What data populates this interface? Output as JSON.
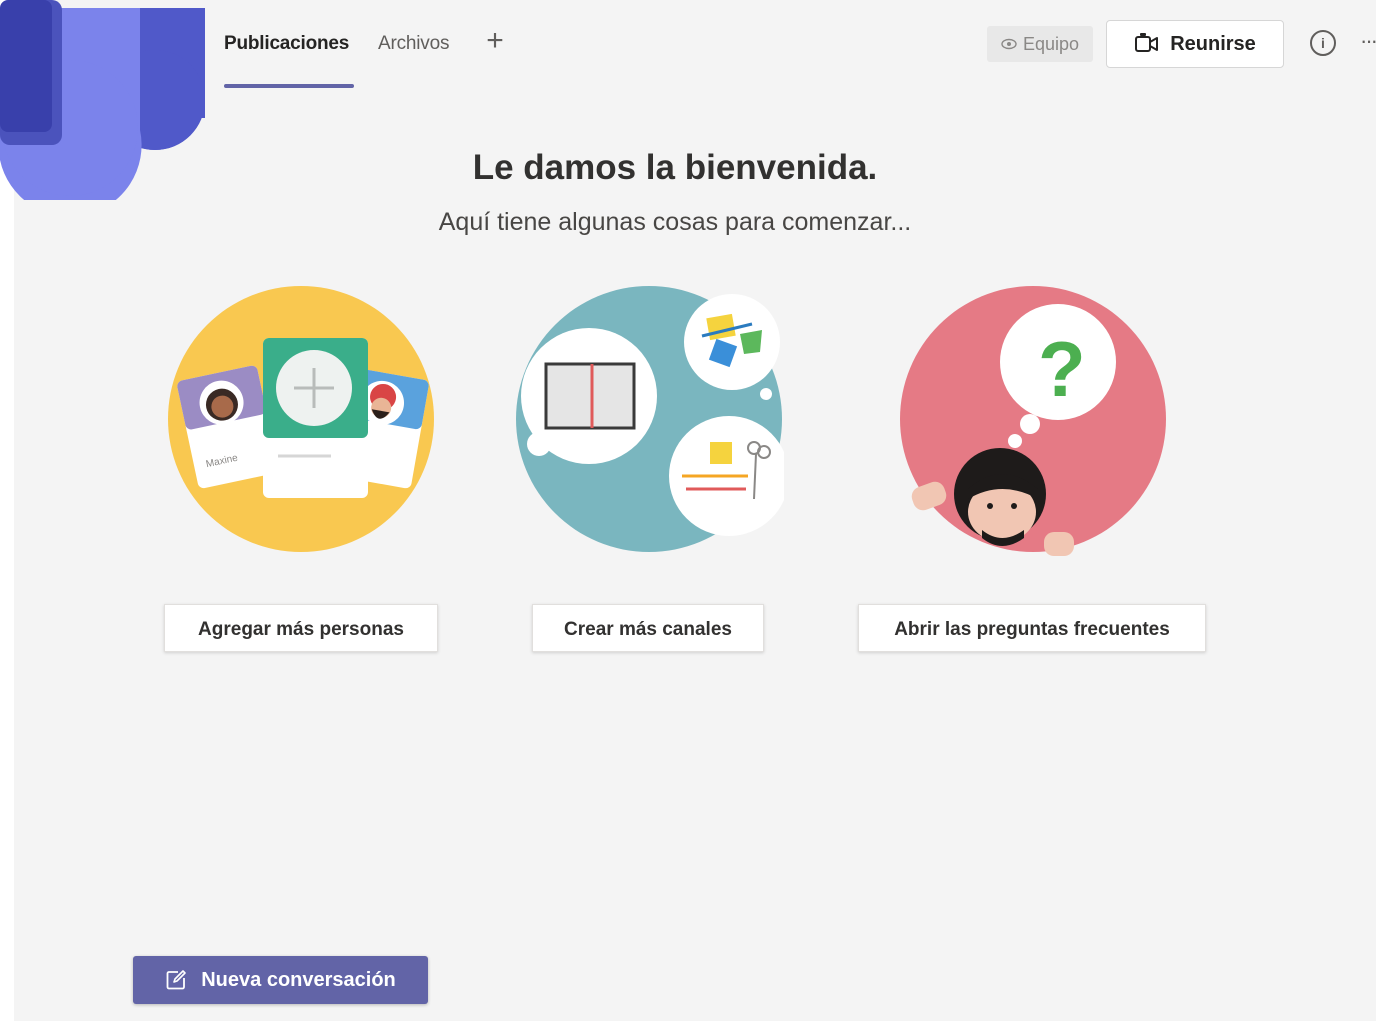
{
  "header": {
    "tabs": [
      {
        "label": "Publicaciones",
        "active": true
      },
      {
        "label": "Archivos",
        "active": false
      }
    ],
    "add_tab_symbol": "+",
    "team_badge": "Equipo",
    "meet_button": "Reunirse",
    "info_symbol": "i",
    "more_symbol": "···"
  },
  "welcome": {
    "title": "Le damos la bienvenida.",
    "subtitle": "Aquí tiene algunas cosas para comenzar..."
  },
  "illustrations": {
    "card_name": "Maxine"
  },
  "actions": [
    {
      "label": "Agregar más personas",
      "icon": "people-cards-illustration"
    },
    {
      "label": "Crear más canales",
      "icon": "channels-illustration"
    },
    {
      "label": "Abrir las preguntas frecuentes",
      "icon": "faq-question-illustration"
    }
  ],
  "compose": {
    "new_conversation": "Nueva conversación"
  },
  "colors": {
    "accent": "#6264a7",
    "yellow": "#f9c850",
    "teal": "#7ab6bf",
    "pink": "#e57a85"
  }
}
